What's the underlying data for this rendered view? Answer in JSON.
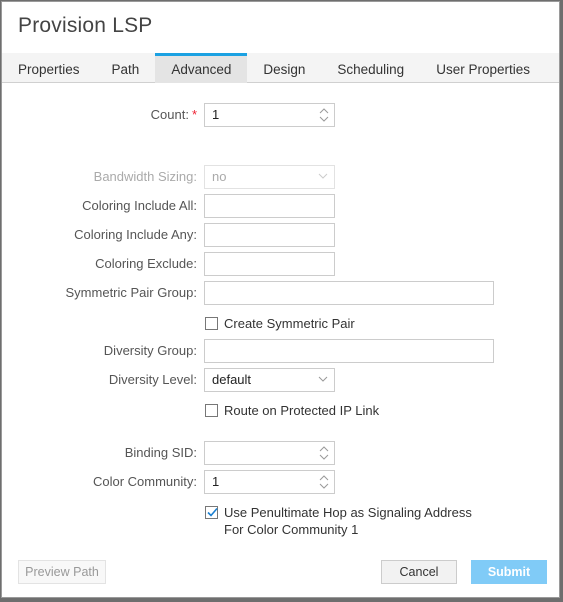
{
  "dialog": {
    "title": "Provision LSP"
  },
  "tabs": [
    {
      "label": "Properties",
      "active": false
    },
    {
      "label": "Path",
      "active": false
    },
    {
      "label": "Advanced",
      "active": true
    },
    {
      "label": "Design",
      "active": false
    },
    {
      "label": "Scheduling",
      "active": false
    },
    {
      "label": "User Properties",
      "active": false
    }
  ],
  "form": {
    "count": {
      "label": "Count:",
      "required_mark": "*",
      "value": "1"
    },
    "bandwidth_sizing": {
      "label": "Bandwidth Sizing:",
      "value": "no",
      "disabled": true
    },
    "coloring_include_all": {
      "label": "Coloring Include All:",
      "value": ""
    },
    "coloring_include_any": {
      "label": "Coloring Include Any:",
      "value": ""
    },
    "coloring_exclude": {
      "label": "Coloring Exclude:",
      "value": ""
    },
    "symmetric_pair_group": {
      "label": "Symmetric Pair Group:",
      "value": ""
    },
    "create_symmetric_pair": {
      "label": "Create Symmetric Pair",
      "checked": false
    },
    "diversity_group": {
      "label": "Diversity Group:",
      "value": ""
    },
    "diversity_level": {
      "label": "Diversity Level:",
      "value": "default"
    },
    "route_on_protected_ip_link": {
      "label": "Route on Protected IP Link",
      "checked": false
    },
    "binding_sid": {
      "label": "Binding SID:",
      "value": ""
    },
    "color_community": {
      "label": "Color Community:",
      "value": "1"
    },
    "use_penultimate_hop": {
      "label_line1": "Use Penultimate Hop as Signaling Address",
      "label_line2": "For Color Community 1",
      "checked": true
    }
  },
  "footer": {
    "preview_path": "Preview Path",
    "cancel": "Cancel",
    "submit": "Submit"
  },
  "colors": {
    "accent": "#1ba1e2",
    "submit_bg": "#80cbf7",
    "required": "#ee2233"
  }
}
